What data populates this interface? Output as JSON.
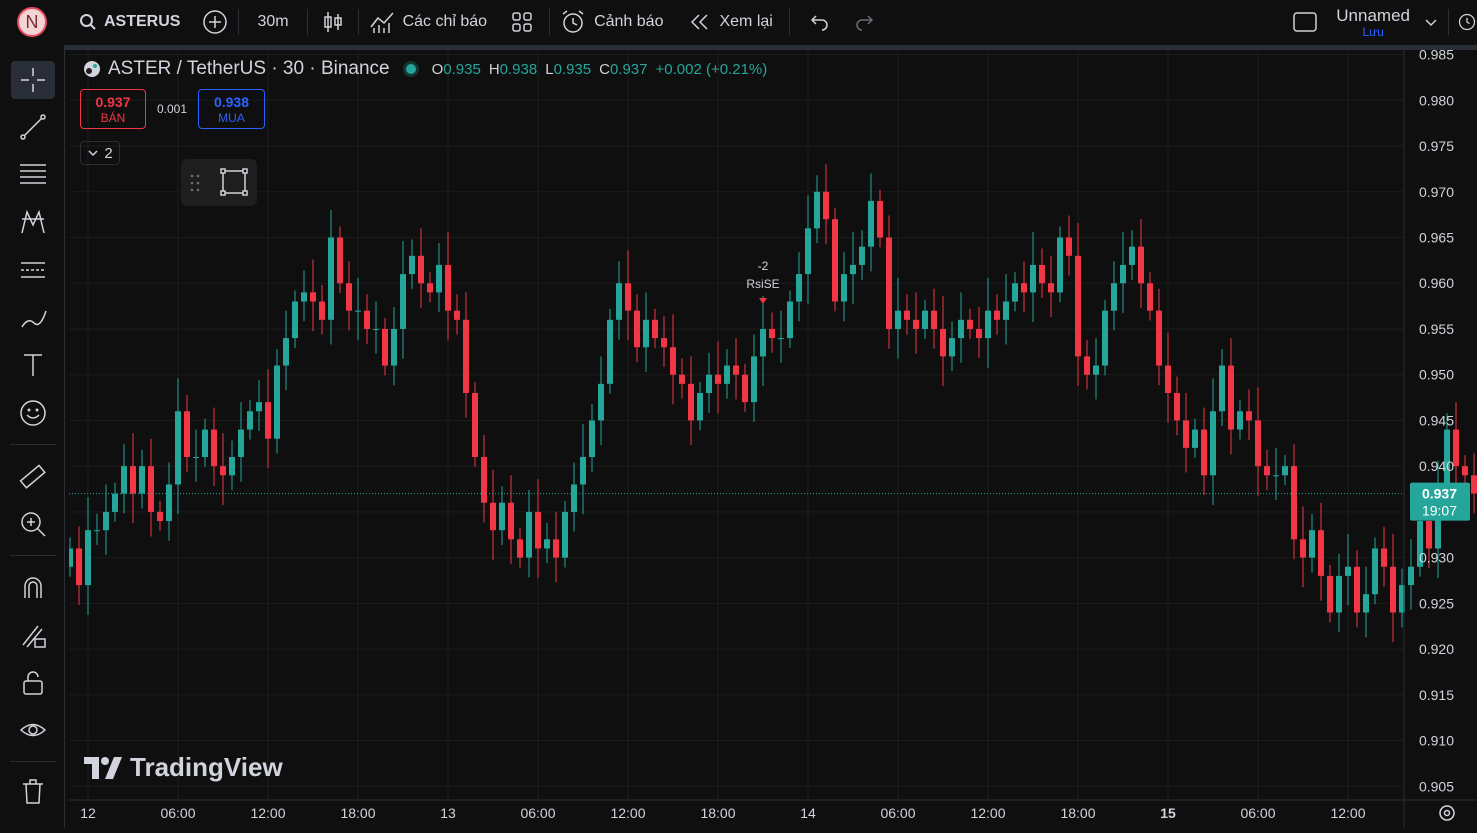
{
  "topbar": {
    "avatar_letter": "N",
    "symbol": "ASTERUS",
    "interval": "30m",
    "indicators_label": "Các chỉ báo",
    "alerts_label": "Cảnh báo",
    "replay_label": "Xem lại",
    "layout_name": "Unnamed",
    "save_label": "Lưu"
  },
  "legend": {
    "title": "ASTER / TetherUS · 30 · Binance",
    "o_label": "O",
    "o_value": "0.935",
    "h_label": "H",
    "h_value": "0.938",
    "l_label": "L",
    "l_value": "0.935",
    "c_label": "C",
    "c_value": "0.937",
    "change": "+0.002 (+0.21%)"
  },
  "trade": {
    "sell_price": "0.937",
    "sell_label": "BÁN",
    "spread": "0.001",
    "buy_price": "0.938",
    "buy_label": "MUA"
  },
  "collapse_count": "2",
  "watermark": "TradingView",
  "colors": {
    "up": "#26a69a",
    "down": "#f23645",
    "background": "#0f0f0f",
    "grid": "#1c1c1c"
  },
  "chart_data": {
    "type": "candlestick",
    "ylim": [
      0.9035,
      0.9855
    ],
    "y_ticks": [
      0.905,
      0.91,
      0.915,
      0.92,
      0.925,
      0.93,
      0.935,
      0.94,
      0.945,
      0.95,
      0.955,
      0.96,
      0.965,
      0.97,
      0.975,
      0.98,
      0.985
    ],
    "x_labels": [
      {
        "label": "12",
        "bar": 2
      },
      {
        "label": "06:00",
        "bar": 12
      },
      {
        "label": "12:00",
        "bar": 22
      },
      {
        "label": "18:00",
        "bar": 32
      },
      {
        "label": "13",
        "bar": 42
      },
      {
        "label": "06:00",
        "bar": 52
      },
      {
        "label": "12:00",
        "bar": 62
      },
      {
        "label": "18:00",
        "bar": 72
      },
      {
        "label": "14",
        "bar": 82
      },
      {
        "label": "06:00",
        "bar": 92
      },
      {
        "label": "12:00",
        "bar": 102
      },
      {
        "label": "18:00",
        "bar": 112
      },
      {
        "label": "15",
        "bar": 122
      },
      {
        "label": "06:00",
        "bar": 132
      },
      {
        "label": "12:00",
        "bar": 142
      }
    ],
    "current_price": "0.937",
    "countdown": "19:07",
    "annotation": {
      "bar": 77,
      "lines": [
        "-2",
        "RsiSE"
      ]
    },
    "closes": [
      0.931,
      0.927,
      0.933,
      0.933,
      0.935,
      0.937,
      0.94,
      0.937,
      0.94,
      0.935,
      0.934,
      0.938,
      0.946,
      0.941,
      0.941,
      0.944,
      0.94,
      0.939,
      0.941,
      0.944,
      0.946,
      0.947,
      0.943,
      0.951,
      0.954,
      0.958,
      0.959,
      0.958,
      0.956,
      0.965,
      0.96,
      0.957,
      0.957,
      0.955,
      0.955,
      0.951,
      0.955,
      0.961,
      0.963,
      0.96,
      0.959,
      0.962,
      0.957,
      0.956,
      0.948,
      0.941,
      0.936,
      0.933,
      0.936,
      0.932,
      0.93,
      0.935,
      0.931,
      0.932,
      0.93,
      0.935,
      0.938,
      0.941,
      0.945,
      0.949,
      0.956,
      0.96,
      0.957,
      0.953,
      0.956,
      0.954,
      0.953,
      0.95,
      0.949,
      0.945,
      0.948,
      0.95,
      0.949,
      0.951,
      0.95,
      0.947,
      0.952,
      0.955,
      0.954,
      0.954,
      0.958,
      0.961,
      0.966,
      0.97,
      0.967,
      0.958,
      0.961,
      0.962,
      0.964,
      0.969,
      0.965,
      0.955,
      0.957,
      0.956,
      0.955,
      0.957,
      0.955,
      0.952,
      0.954,
      0.956,
      0.955,
      0.954,
      0.957,
      0.956,
      0.958,
      0.96,
      0.959,
      0.962,
      0.96,
      0.959,
      0.965,
      0.963,
      0.952,
      0.95,
      0.951,
      0.957,
      0.96,
      0.962,
      0.964,
      0.96,
      0.957,
      0.951,
      0.948,
      0.945,
      0.942,
      0.944,
      0.939,
      0.946,
      0.951,
      0.944,
      0.946,
      0.945,
      0.94,
      0.939,
      0.939,
      0.94,
      0.932,
      0.93,
      0.933,
      0.928,
      0.924,
      0.928,
      0.929,
      0.924,
      0.926,
      0.931,
      0.929,
      0.924,
      0.927,
      0.929,
      0.934,
      0.931,
      0.937,
      0.944,
      0.94,
      0.939,
      0.937
    ]
  }
}
